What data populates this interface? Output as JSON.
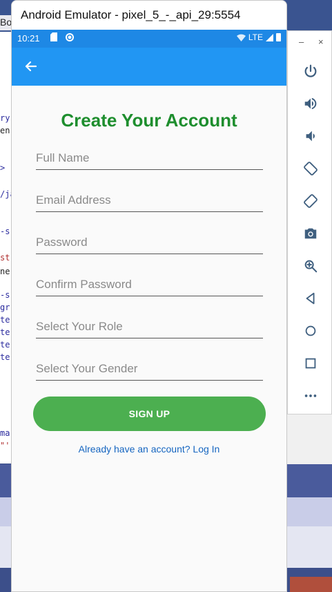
{
  "window": {
    "title": "Android Emulator - pixel_5_-_api_29:5554",
    "minimize_label": "–",
    "close_label": "×"
  },
  "background": {
    "tab_fragment": "Bo",
    "code_fragments": [
      "ry",
      "en",
      ">",
      "/ja",
      "-s",
      "str",
      "ne",
      "-s",
      "gr",
      "te",
      "te",
      "te",
      "te",
      "ma",
      "\"'"
    ]
  },
  "status_bar": {
    "time": "10:21",
    "network": "LTE"
  },
  "form": {
    "title": "Create Your Account",
    "fields": [
      {
        "placeholder": "Full Name",
        "value": ""
      },
      {
        "placeholder": "Email Address",
        "value": ""
      },
      {
        "placeholder": "Password",
        "value": ""
      },
      {
        "placeholder": "Confirm Password",
        "value": ""
      },
      {
        "placeholder": "Select Your Role",
        "value": ""
      },
      {
        "placeholder": "Select Your Gender",
        "value": ""
      }
    ],
    "signup_label": "SIGN UP",
    "login_link": "Already have an account? Log In"
  },
  "toolbar_icons": [
    "power-icon",
    "volume-up-icon",
    "volume-down-icon",
    "rotate-left-icon",
    "rotate-right-icon",
    "camera-icon",
    "zoom-icon",
    "back-icon",
    "home-icon",
    "overview-icon",
    "more-icon"
  ],
  "colors": {
    "app_bar": "#2196f3",
    "status_bar": "#1e88e5",
    "title_green": "#1e8e2e",
    "button_green": "#4caf50",
    "link_blue": "#1565c0"
  }
}
